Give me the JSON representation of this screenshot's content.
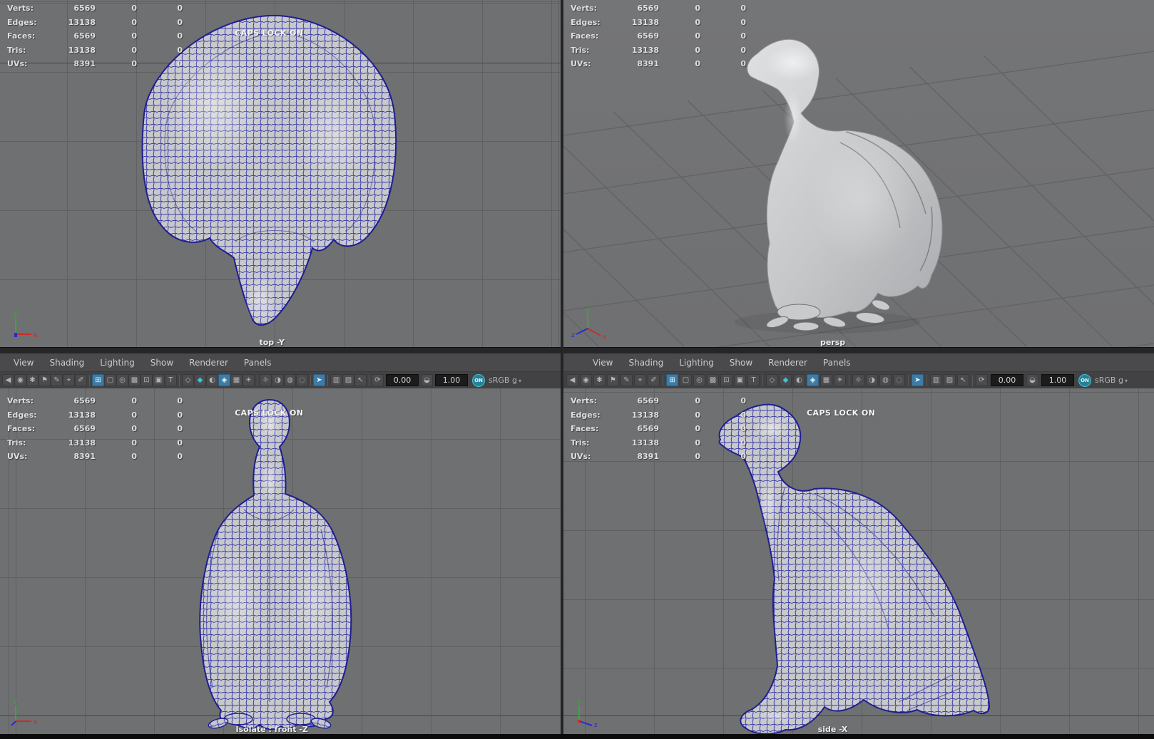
{
  "window": {
    "app_context": "maya-four-view-layout"
  },
  "hud": {
    "rows": [
      {
        "label": "Verts:",
        "v1": "6569",
        "v2": "0",
        "v3": "0"
      },
      {
        "label": "Edges:",
        "v1": "13138",
        "v2": "0",
        "v3": "0"
      },
      {
        "label": "Faces:",
        "v1": "6569",
        "v2": "0",
        "v3": "0"
      },
      {
        "label": "Tris:",
        "v1": "13138",
        "v2": "0",
        "v3": "0"
      },
      {
        "label": "UVs:",
        "v1": "8391",
        "v2": "0",
        "v3": "0"
      }
    ]
  },
  "overlays": {
    "caps_lock": "CAPS LOCK ON"
  },
  "viewports": {
    "top_left": {
      "camera_label": "top -Y"
    },
    "top_right": {
      "camera_label": "persp"
    },
    "bottom_left": {
      "camera_label": "Isolate : front -Z"
    },
    "bottom_right": {
      "camera_label": "side -X"
    }
  },
  "viewport_menu": {
    "items": [
      "View",
      "Shading",
      "Lighting",
      "Show",
      "Renderer",
      "Panels"
    ]
  },
  "viewport_toolbar": {
    "exposure_value": "0.00",
    "gamma_value": "1.00",
    "toggle_label": "ON",
    "colorspace_label": "sRGB g",
    "items": [
      {
        "t": "icon",
        "n": "select-camera-icon",
        "g": "◀"
      },
      {
        "t": "icon",
        "n": "lock-camera-icon",
        "g": "◉"
      },
      {
        "t": "icon",
        "n": "camera-attributes-icon",
        "g": "✱"
      },
      {
        "t": "icon",
        "n": "bookmark-icon",
        "g": "⚑"
      },
      {
        "t": "icon",
        "n": "image-plane-icon",
        "g": "✎"
      },
      {
        "t": "icon",
        "n": "pan-zoom-icon",
        "g": "⌖"
      },
      {
        "t": "icon",
        "n": "grease-pencil-icon",
        "g": "✐"
      },
      {
        "t": "sep"
      },
      {
        "t": "icon",
        "n": "grid-icon",
        "g": "⊞",
        "active": true
      },
      {
        "t": "icon",
        "n": "film-gate-icon",
        "g": "▢"
      },
      {
        "t": "icon",
        "n": "resolution-gate-icon",
        "g": "◎"
      },
      {
        "t": "icon",
        "n": "gate-mask-icon",
        "g": "▩"
      },
      {
        "t": "icon",
        "n": "field-chart-icon",
        "g": "⊡"
      },
      {
        "t": "icon",
        "n": "safe-action-icon",
        "g": "▣"
      },
      {
        "t": "icon",
        "n": "safe-title-icon",
        "g": "T"
      },
      {
        "t": "sep"
      },
      {
        "t": "icon",
        "n": "wireframe-icon",
        "g": "◇"
      },
      {
        "t": "icon",
        "n": "shaded-icon",
        "g": "◆",
        "teal": true
      },
      {
        "t": "icon",
        "n": "textured-icon",
        "g": "◐"
      },
      {
        "t": "icon",
        "n": "wireframe-on-shaded-icon",
        "g": "◈",
        "active": true
      },
      {
        "t": "icon",
        "n": "checkered-icon",
        "g": "▦"
      },
      {
        "t": "icon",
        "n": "default-material-icon",
        "g": "☀"
      },
      {
        "t": "sep"
      },
      {
        "t": "icon",
        "n": "lighting-icon",
        "g": "☼"
      },
      {
        "t": "icon",
        "n": "shadows-icon",
        "g": "◑"
      },
      {
        "t": "icon",
        "n": "occlusion-icon",
        "g": "◍"
      },
      {
        "t": "icon",
        "n": "motion-blur-icon",
        "g": "◌"
      },
      {
        "t": "sep"
      },
      {
        "t": "icon",
        "n": "isolate-select-icon",
        "g": "➤",
        "active": true
      },
      {
        "t": "sep"
      },
      {
        "t": "icon",
        "n": "xray-icon",
        "g": "▥"
      },
      {
        "t": "icon",
        "n": "xray-active-icon",
        "g": "▨"
      },
      {
        "t": "icon",
        "n": "fit-view-icon",
        "g": "↖"
      },
      {
        "t": "sep"
      },
      {
        "t": "icon",
        "n": "exposure-icon",
        "g": "⟳"
      },
      {
        "t": "field",
        "n": "exposure-field",
        "bind": "exposure_value"
      },
      {
        "t": "icon",
        "n": "gamma-icon",
        "g": "◒"
      },
      {
        "t": "field",
        "n": "gamma-field",
        "bind": "gamma_value"
      },
      {
        "t": "toggle",
        "n": "view-transform-toggle",
        "bind": "toggle_label"
      },
      {
        "t": "label",
        "n": "colorspace-label",
        "bind": "colorspace_label",
        "caret": true
      }
    ]
  },
  "axis_gizmo": {
    "x": "x",
    "y": "y",
    "z": "z"
  },
  "colors": {
    "accent_teal": "#41c4d4",
    "wireframe_blue": "#2b2b9b",
    "viewport_bg": "#6f7072",
    "model_gray": "#c8c9cb"
  }
}
